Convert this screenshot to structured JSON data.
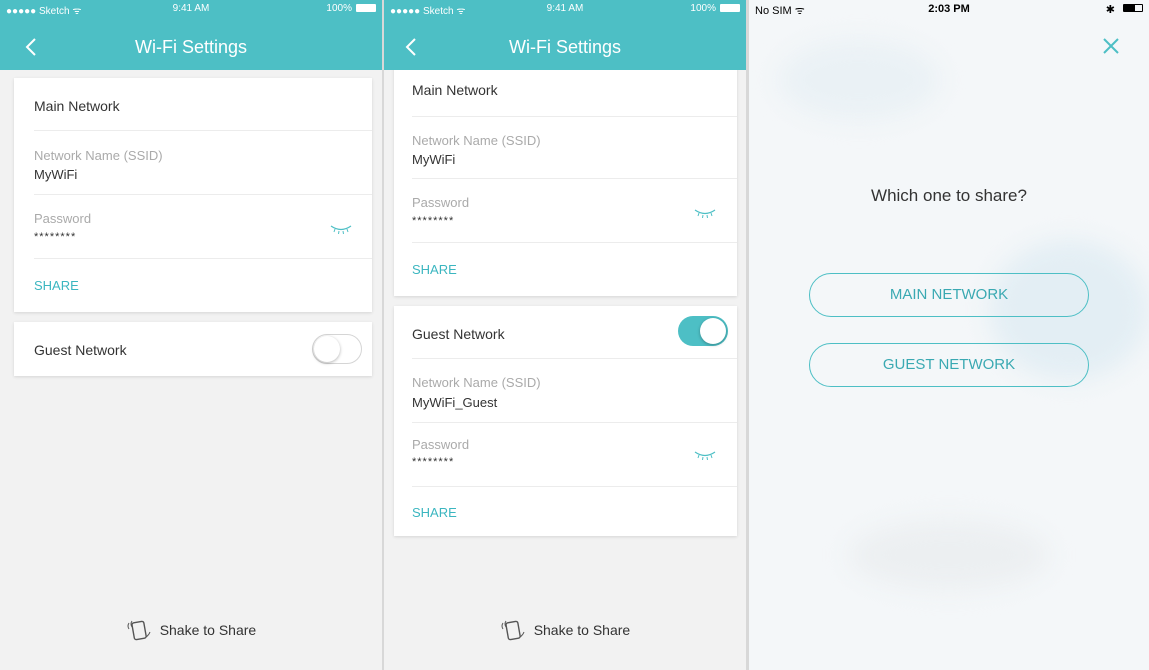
{
  "screen1": {
    "status": {
      "carrier": "●●●●● Sketch ᯤ",
      "time": "9:41 AM",
      "battery": "100%"
    },
    "header": {
      "title": "Wi-Fi Settings"
    },
    "main": {
      "title": "Main Network",
      "ssid_label": "Network Name (SSID)",
      "ssid_value": "MyWiFi",
      "password_label": "Password",
      "password_value": "********",
      "share_label": "SHARE"
    },
    "guest": {
      "title": "Guest Network",
      "enabled": false
    },
    "shake_label": "Shake to Share"
  },
  "screen2": {
    "status": {
      "carrier": "●●●●● Sketch ᯤ",
      "time": "9:41 AM",
      "battery": "100%"
    },
    "header": {
      "title": "Wi-Fi Settings"
    },
    "main": {
      "title": "Main Network",
      "ssid_label": "Network Name (SSID)",
      "ssid_value": "MyWiFi",
      "password_label": "Password",
      "password_value": "********",
      "share_label": "SHARE"
    },
    "guest": {
      "title": "Guest Network",
      "enabled": true,
      "ssid_label": "Network Name (SSID)",
      "ssid_value": "MyWiFi_Guest",
      "password_label": "Password",
      "password_value": "********",
      "share_label": "SHARE"
    },
    "shake_label": "Shake to Share"
  },
  "screen3": {
    "status": {
      "carrier": "No SIM ᯤ",
      "time": "2:03 PM",
      "bluetooth": "✱"
    },
    "question": "Which one to share?",
    "options": [
      "MAIN NETWORK",
      "GUEST NETWORK"
    ]
  },
  "colors": {
    "accent": "#4dbfc5",
    "link": "#3bb6c0",
    "background": "#f2f2f2"
  },
  "icons": [
    "chevron-left-icon",
    "eye-closed-icon",
    "shake-phone-icon",
    "close-icon",
    "wifi-icon",
    "battery-icon"
  ]
}
